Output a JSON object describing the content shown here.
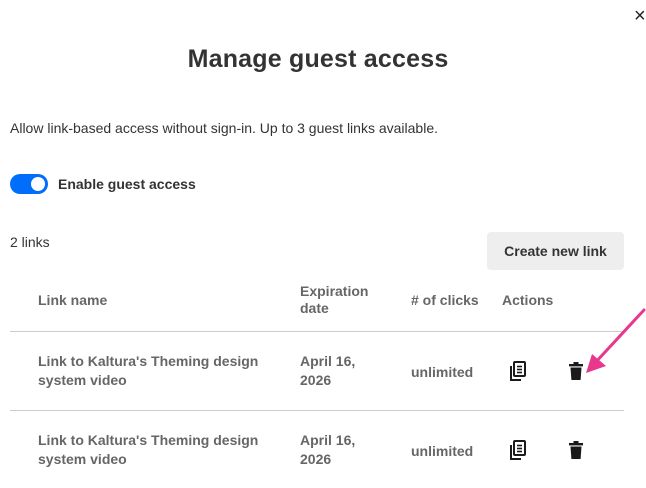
{
  "dialog": {
    "close_glyph": "×",
    "title": "Manage guest access",
    "description": "Allow link-based access without sign-in. Up to 3 guest links available.",
    "toggle": {
      "label": "Enable guest access",
      "enabled": true
    },
    "link_count": "2 links",
    "create_button": "Create new link"
  },
  "table": {
    "headers": {
      "name": "Link name",
      "expiration": "Expiration date",
      "clicks": "# of clicks",
      "actions": "Actions"
    },
    "rows": [
      {
        "name": "Link to Kaltura's Theming design system video",
        "expiration": "April 16, 2026",
        "clicks": "unlimited"
      },
      {
        "name": "Link to Kaltura's Theming design system video",
        "expiration": "April 16, 2026",
        "clicks": "unlimited"
      }
    ]
  },
  "icons": {
    "close": "close-icon",
    "copy": "copy-icon",
    "delete": "trash-icon",
    "annotation": "arrow-icon"
  },
  "colors": {
    "accent": "#006efa",
    "annotation_arrow": "#e8378d",
    "button_bg": "#eeeeee",
    "muted_text": "#666666"
  }
}
